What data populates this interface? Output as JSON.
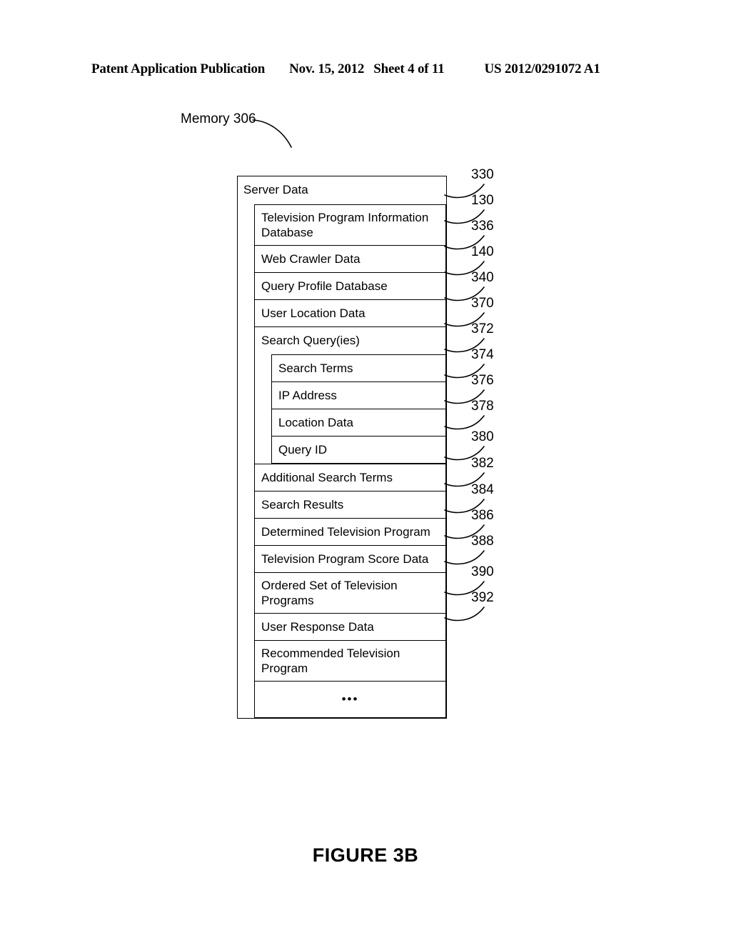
{
  "header": {
    "publication": "Patent Application Publication",
    "date": "Nov. 15, 2012",
    "sheet": "Sheet 4 of 11",
    "patent_number": "US 2012/0291072 A1"
  },
  "memory_label": "Memory 306",
  "figure_caption": "FIGURE 3B",
  "diagram": {
    "root": {
      "title": "Server Data",
      "ref": "330"
    },
    "items": [
      {
        "label": "Television Program Information Database",
        "ref": "130",
        "lines": 2
      },
      {
        "label": "Web Crawler Data",
        "ref": "336",
        "lines": 1
      },
      {
        "label": "Query Profile Database",
        "ref": "140",
        "lines": 1
      },
      {
        "label": "User Location Data",
        "ref": "340",
        "lines": 1
      },
      {
        "label": "Search Query(ies)",
        "ref": "370",
        "lines": 1,
        "children": [
          {
            "label": "Search Terms",
            "ref": "372",
            "lines": 1
          },
          {
            "label": "IP Address",
            "ref": "374",
            "lines": 1
          },
          {
            "label": "Location Data",
            "ref": "376",
            "lines": 1
          },
          {
            "label": "Query ID",
            "ref": "378",
            "lines": 1
          }
        ]
      },
      {
        "label": "Additional Search Terms",
        "ref": "380",
        "lines": 1
      },
      {
        "label": "Search Results",
        "ref": "382",
        "lines": 1
      },
      {
        "label": "Determined Television Program",
        "ref": "384",
        "lines": 1
      },
      {
        "label": "Television Program Score Data",
        "ref": "386",
        "lines": 1
      },
      {
        "label": "Ordered Set of Television Programs",
        "ref": "388",
        "lines": 2
      },
      {
        "label": "User Response Data",
        "ref": "390",
        "lines": 1
      },
      {
        "label": "Recommended Television Program",
        "ref": "392",
        "lines": 2
      },
      {
        "label": "•••",
        "ref": "",
        "lines": 1,
        "ellipsis": true
      }
    ],
    "reference_numerals": [
      "330",
      "130",
      "336",
      "140",
      "340",
      "370",
      "372",
      "374",
      "376",
      "378",
      "380",
      "382",
      "384",
      "386",
      "388",
      "390",
      "392"
    ]
  },
  "colors": {
    "ink": "#000000",
    "paper": "#ffffff"
  }
}
